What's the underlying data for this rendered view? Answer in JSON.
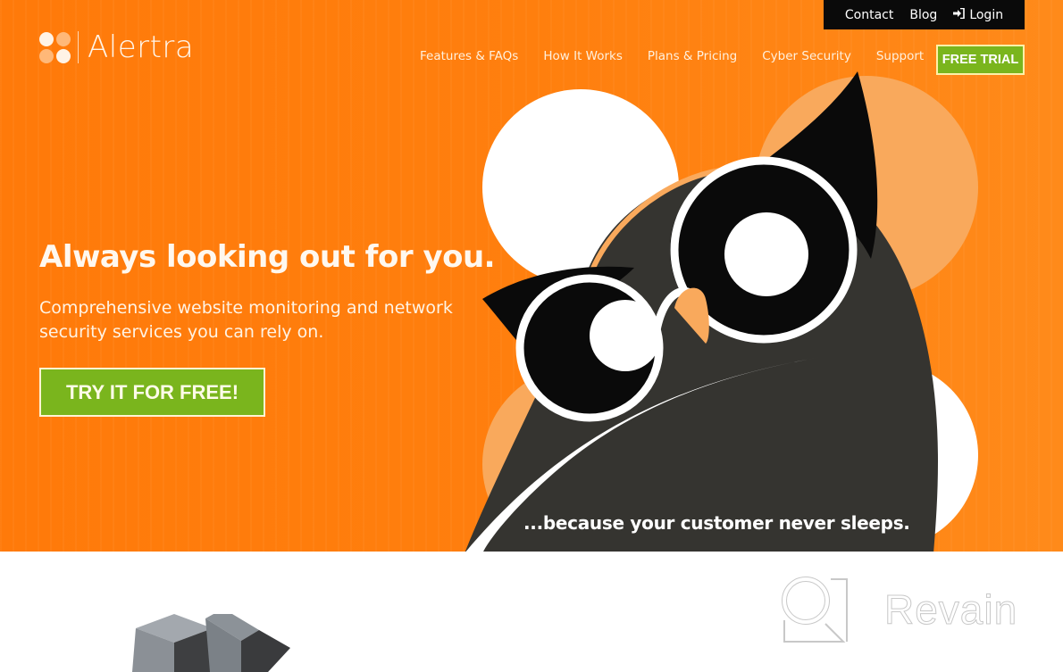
{
  "brand": {
    "name": "Alertra",
    "logo_icon": "four-dots-logo-icon"
  },
  "topbar": {
    "items": [
      {
        "label": "Contact"
      },
      {
        "label": "Blog"
      },
      {
        "label": "Login",
        "icon": "sign-in-icon",
        "icon_glyph": "➜]"
      }
    ]
  },
  "nav": {
    "items": [
      {
        "label": "Features & FAQs"
      },
      {
        "label": "How It Works"
      },
      {
        "label": "Plans & Pricing"
      },
      {
        "label": "Cyber Security"
      },
      {
        "label": "Support"
      }
    ],
    "cta_label": "FREE TRIAL"
  },
  "hero": {
    "headline": "Always looking out for you.",
    "subhead": "Comprehensive website monitoring and network security services you can rely on.",
    "cta_label": "TRY IT FOR FREE!",
    "tagline": "...because your customer never sleeps.",
    "illustration": "owl-with-glasses-illustration"
  },
  "watermark": {
    "text": "Revain",
    "icon": "revain-logo-icon"
  },
  "colors": {
    "hero_orange": "#ff7f0e",
    "light_orange": "#f9a95c",
    "accent_green": "#7ab51d",
    "owl_dark": "#353430",
    "topbar_black": "#0a0a0a"
  }
}
